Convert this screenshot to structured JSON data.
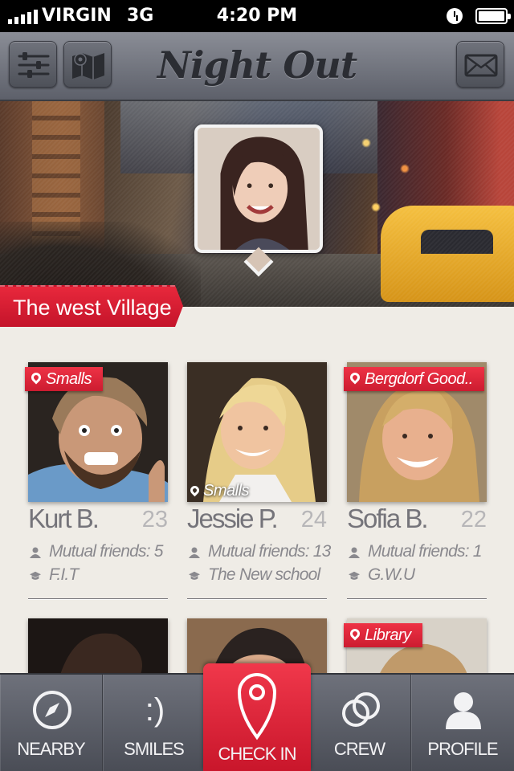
{
  "status_bar": {
    "carrier": "VIRGIN",
    "network": "3G",
    "time": "4:20 PM"
  },
  "nav": {
    "title": "Night Out",
    "left_icons": [
      "sliders-icon",
      "map-icon"
    ],
    "right_icon": "mail-icon"
  },
  "hero": {
    "location": "The west Village"
  },
  "people": [
    {
      "name": "Kurt B.",
      "age": "23",
      "tag": "Smalls",
      "mutual": "Mutual friends: 5",
      "school": "F.I.T"
    },
    {
      "name": "Jessie P.",
      "age": "24",
      "caption": "Smalls",
      "mutual": "Mutual friends: 13",
      "school": "The New school"
    },
    {
      "name": "Sofia B.",
      "age": "22",
      "tag": "Bergdorf Good..",
      "mutual": "Mutual friends: 1",
      "school": "G.W.U"
    },
    {
      "tag": "Library"
    }
  ],
  "tabs": [
    {
      "label": "NEARBY",
      "icon": "compass-icon"
    },
    {
      "label": "SMILES",
      "icon": "smiley-icon",
      "glyph": ":)"
    },
    {
      "label": "CHECK IN",
      "icon": "location-pin-icon",
      "active": true
    },
    {
      "label": "CREW",
      "icon": "crew-rings-icon"
    },
    {
      "label": "PROFILE",
      "icon": "user-icon"
    }
  ],
  "colors": {
    "accent": "#e0233a",
    "nav_bg": "#6e717b",
    "page_bg": "#efece6"
  }
}
